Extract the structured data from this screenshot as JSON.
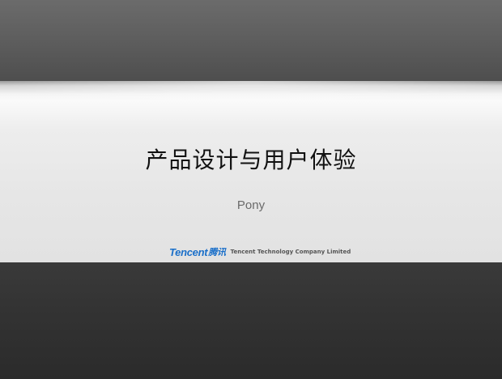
{
  "slide": {
    "title": "产品设计与用户体验",
    "subtitle": "Pony",
    "footer": {
      "logo_latin": "Tencent",
      "logo_chinese": "腾讯",
      "company": "Tencent Technology Company Limited"
    }
  },
  "colors": {
    "logo_blue": "#1a6fc9",
    "title_text": "#111111",
    "band_top": "#5c5c5c",
    "band_middle": "#ececec",
    "band_bottom": "#333333"
  }
}
